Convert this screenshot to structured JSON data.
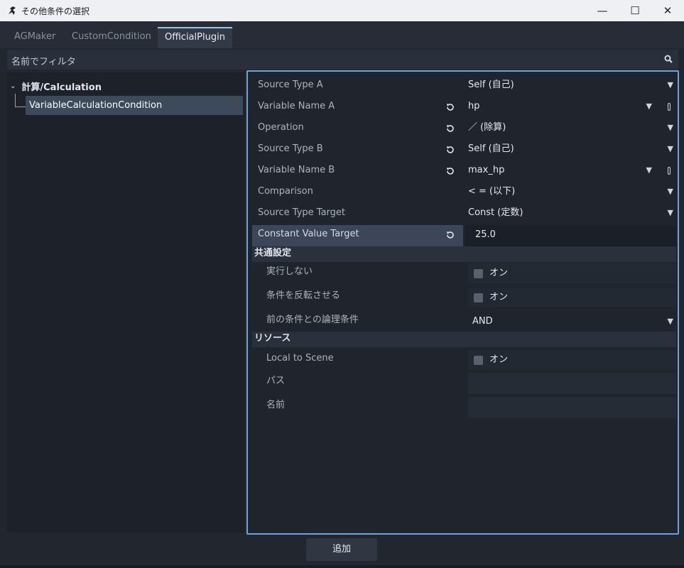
{
  "window": {
    "title": "その他条件の選択",
    "controls": [
      "—",
      "☐",
      "✕"
    ]
  },
  "tabs": [
    {
      "label": "AGMaker",
      "active": false
    },
    {
      "label": "CustomCondition",
      "active": false
    },
    {
      "label": "OfficialPlugin",
      "active": true
    }
  ],
  "filter": {
    "placeholder": "名前でフィルタ"
  },
  "tree": {
    "root_label": "計算/Calculation",
    "item_label": "VariableCalculationCondition"
  },
  "properties": [
    {
      "label": "Source Type A",
      "value": "Self (自己)",
      "revertable": false,
      "dropdown": true
    },
    {
      "label": "Variable Name A",
      "value": "hp",
      "revertable": true,
      "dropdown": true,
      "pin": true
    },
    {
      "label": "Operation",
      "value": "／ (除算)",
      "revertable": true,
      "dropdown": true
    },
    {
      "label": "Source Type B",
      "value": "Self (自己)",
      "revertable": true,
      "dropdown": true
    },
    {
      "label": "Variable Name B",
      "value": "max_hp",
      "revertable": true,
      "dropdown": true,
      "pin": true
    },
    {
      "label": "Comparison",
      "value": "< = (以下)",
      "revertable": false,
      "dropdown": true
    },
    {
      "label": "Source Type Target",
      "value": "Const (定数)",
      "revertable": false,
      "dropdown": true
    },
    {
      "label": "Constant Value Target",
      "value": "25.0",
      "revertable": true,
      "selected": true
    }
  ],
  "common_section": {
    "title": "共通設定",
    "no_execute": {
      "label": "実行しない",
      "checkbox_label": "オン"
    },
    "invert": {
      "label": "条件を反転させる",
      "checkbox_label": "オン"
    },
    "logic": {
      "label": "前の条件との論理条件",
      "value": "AND"
    }
  },
  "resource_section": {
    "title": "リソース",
    "local_to_scene": {
      "label": "Local to Scene",
      "checkbox_label": "オン"
    },
    "path": {
      "label": "パス",
      "value": ""
    },
    "name": {
      "label": "名前",
      "value": ""
    }
  },
  "buttons": {
    "add": "追加"
  },
  "colors": {
    "accent": "#6aa4d8",
    "selected_row": "#3c4a5c",
    "bg": "#21262f"
  },
  "icons": {
    "dropdown": "chevron-down-icon",
    "revert": "revert-icon",
    "search": "search-icon"
  }
}
